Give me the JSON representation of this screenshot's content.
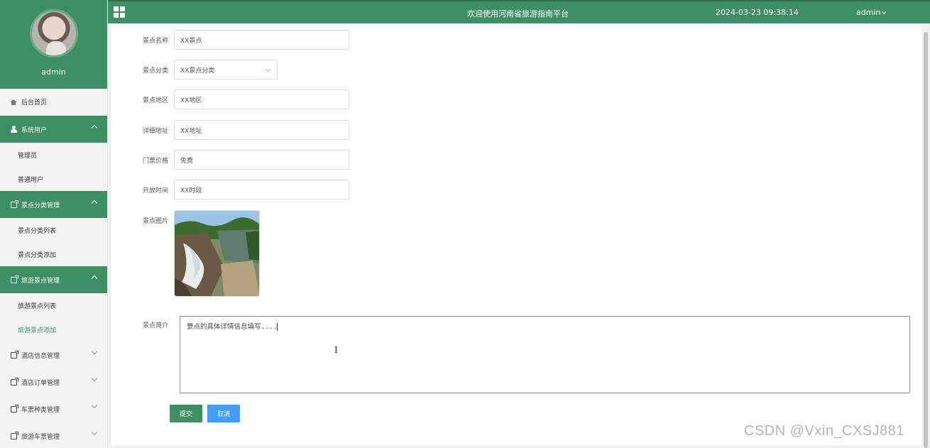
{
  "sidebar": {
    "profile_name": "admin",
    "home": "后台首页",
    "groups": [
      {
        "label": "系统用户",
        "expanded": true,
        "items": [
          "管理员",
          "普通用户"
        ]
      },
      {
        "label": "景点分类管理",
        "expanded": true,
        "items": [
          "景点分类列表",
          "景点分类添加"
        ]
      },
      {
        "label": "旅游景点管理",
        "expanded": true,
        "items": [
          "旅游景点列表",
          "旅游景点添加"
        ]
      },
      {
        "label": "酒店信息管理",
        "expanded": false,
        "items": []
      },
      {
        "label": "酒店订单管理",
        "expanded": false,
        "items": []
      },
      {
        "label": "车票种类管理",
        "expanded": false,
        "items": []
      },
      {
        "label": "旅游车票管理",
        "expanded": false,
        "items": []
      }
    ],
    "active_item": "旅游景点添加"
  },
  "header": {
    "title": "欢迎使用河南省旅游指南平台",
    "datetime": "2024-03-23 09:38:14",
    "user": "admin"
  },
  "form": {
    "name": {
      "label": "景点名称",
      "value": "XX景点"
    },
    "category": {
      "label": "景点分类",
      "value": "XX景点分类"
    },
    "region": {
      "label": "景点地区",
      "value": "XX地区"
    },
    "address": {
      "label": "详细地址",
      "value": "XX地址"
    },
    "price": {
      "label": "门票价格",
      "value": "免费"
    },
    "hours": {
      "label": "开放时间",
      "value": "XX时段"
    },
    "image": {
      "label": "景点图片"
    },
    "intro": {
      "label": "景点简介",
      "value": "景点的具体详情信息填写...."
    },
    "submit_label": "提交",
    "cancel_label": "取消"
  },
  "watermark": "CSDN @Vxin_CXSJ881",
  "colors": {
    "primary": "#3e8f64",
    "accent": "#409eff"
  }
}
